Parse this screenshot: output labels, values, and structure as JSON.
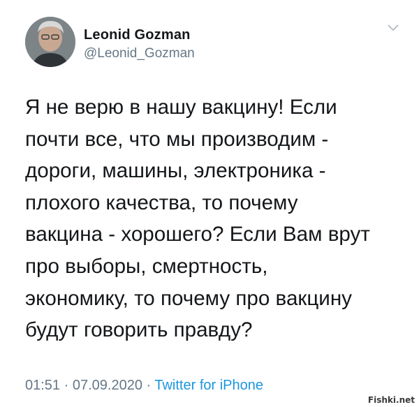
{
  "author": {
    "display_name": "Leonid Gozman",
    "handle": "@Leonid_Gozman",
    "avatar_icon": "profile-photo"
  },
  "menu": {
    "icon": "chevron-down-icon"
  },
  "tweet": {
    "lines": [
      "Я не верю в нашу вакцину! Если",
      "почти все, что мы производим -",
      "дороги, машины, электроника -",
      "плохого качества, то почему",
      "вакцина - хорошего? Если Вам врут",
      "про выборы, смертность,",
      "экономику, то почему про вакцину",
      "будут говорить правду?"
    ]
  },
  "meta": {
    "time": "01:51",
    "separator": " · ",
    "date": "07.09.2020",
    "source": "Twitter for iPhone"
  },
  "watermark": {
    "text": "Fishki.net"
  },
  "colors": {
    "text": "#14171a",
    "secondary": "#657786",
    "link": "#1b95e0"
  }
}
